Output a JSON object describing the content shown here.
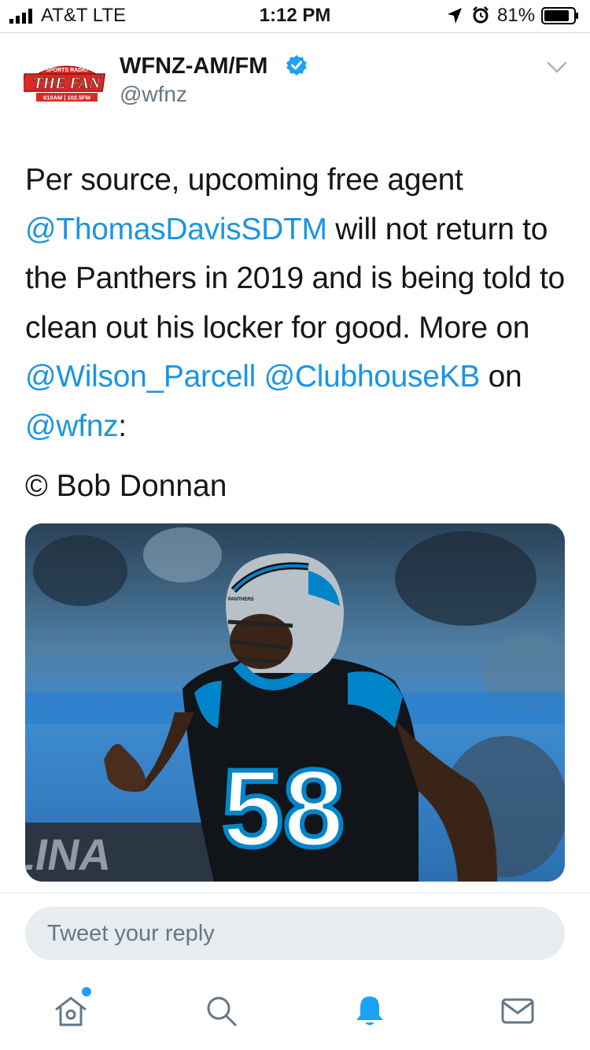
{
  "status_bar": {
    "carrier": "AT&T  LTE",
    "time": "1:12 PM",
    "battery": "81%"
  },
  "tweet": {
    "avatar": {
      "top_text": "SPORTS RADIO",
      "main_text": "THE FAN",
      "sub_text": "610AM | 102.5FM"
    },
    "author_name": "WFNZ-AM/FM",
    "author_handle": "@wfnz",
    "text": {
      "t1": "Per source, upcoming free agent ",
      "m1": "@ThomasDavisSDTM",
      "t2": " will not return to the Panthers in 2019 and is being told to clean out his locker for good. More on ",
      "m2": "@Wilson_Parcell",
      "t3": " ",
      "m3": "@ClubhouseKB",
      "t4": " on ",
      "m4": "@wfnz",
      "t5": ":"
    },
    "photo_credit": "© Bob Donnan",
    "media": {
      "jersey_number": "58",
      "helmet_text": "PANTHERS"
    }
  },
  "reply": {
    "placeholder": "Tweet your reply"
  },
  "tab_bar": {
    "items": [
      {
        "icon": "home-icon",
        "has_dot": true
      },
      {
        "icon": "search-icon"
      },
      {
        "icon": "notifications-icon",
        "active": true
      },
      {
        "icon": "messages-icon"
      }
    ]
  },
  "colors": {
    "accent": "#1da1f2",
    "link": "#1b95e0",
    "secondary_text": "#657786",
    "panthers_blue": "#0085ca"
  }
}
